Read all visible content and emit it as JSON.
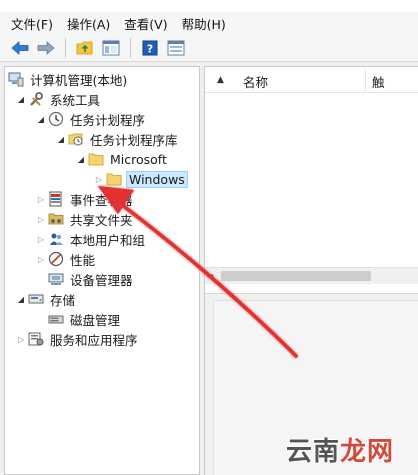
{
  "menubar": {
    "items": [
      "文件(F)",
      "操作(A)",
      "查看(V)",
      "帮助(H)"
    ]
  },
  "toolbar": {
    "buttons": [
      "back-arrow-icon",
      "forward-arrow-icon",
      "up-folder-icon",
      "show-hide-tree-icon",
      "help-icon",
      "properties-icon"
    ]
  },
  "tree": {
    "root": "计算机管理(本地)",
    "system_tools": "系统工具",
    "task_scheduler": "任务计划程序",
    "task_library": "任务计划程序库",
    "microsoft": "Microsoft",
    "windows": "Windows",
    "event_viewer": "事件查看器",
    "shared_folders": "共享文件夹",
    "local_users": "本地用户和组",
    "performance": "性能",
    "device_manager": "设备管理器",
    "storage": "存储",
    "disk_management": "磁盘管理",
    "services_apps": "服务和应用程序"
  },
  "list": {
    "column_name": "名称",
    "column_extra": "触"
  },
  "watermark": {
    "part1": "云南",
    "part2": "龙网"
  },
  "colors": {
    "selection_bg": "#cce8ff",
    "arrow_red": "#e03030"
  }
}
